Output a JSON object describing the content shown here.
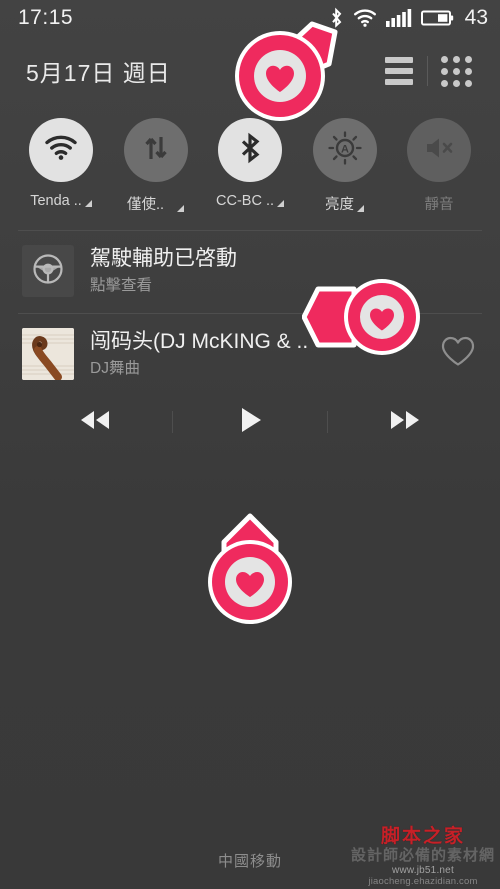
{
  "statusbar": {
    "time": "17:15",
    "battery_level": "43",
    "icons": [
      "bluetooth-icon",
      "wifi-icon",
      "signal-icon",
      "battery-icon"
    ]
  },
  "header": {
    "date": "5月17日 週日",
    "list_button": "list-view-button",
    "grid_button": "grid-view-button"
  },
  "toggles": [
    {
      "name": "wifi",
      "icon": "wifi-icon",
      "label": "Tenda ..",
      "state": "on",
      "has_caret": true
    },
    {
      "name": "data",
      "icon": "data-icon",
      "label": "僅使..",
      "state": "off",
      "has_caret": true
    },
    {
      "name": "bluetooth",
      "icon": "bluetooth-icon",
      "label": "CC-BC ..",
      "state": "on",
      "has_caret": true
    },
    {
      "name": "brightness",
      "icon": "brightness-icon",
      "label": "亮度",
      "state": "off",
      "has_caret": true
    },
    {
      "name": "mute",
      "icon": "mute-icon",
      "label": "靜音",
      "state": "dim",
      "has_caret": false
    }
  ],
  "notifications": [
    {
      "id": "driving-assist",
      "icon": "steering-wheel-icon",
      "title": "駕駛輔助已啓動",
      "subtitle": "點擊查看"
    },
    {
      "id": "music-player",
      "icon": "album-art",
      "title": "闯码头(DJ McKING &  ..",
      "subtitle": "DJ舞曲",
      "action_icon": "heart-outline-icon"
    }
  ],
  "media_controls": [
    {
      "name": "previous-button",
      "icon": "rewind-icon"
    },
    {
      "name": "play-button",
      "icon": "play-icon"
    },
    {
      "name": "next-button",
      "icon": "fast-forward-icon"
    }
  ],
  "footer": {
    "carrier": "中國移動"
  },
  "watermark": {
    "brand": "脚本之家",
    "tagline": "設計師必備的素材網",
    "url": "www.jb51.net",
    "url2": "jiaocheng.ehazidian.com"
  },
  "pointer_badges": [
    {
      "name": "heart-pointer-top",
      "direction": "up-right"
    },
    {
      "name": "heart-pointer-middle",
      "direction": "left"
    },
    {
      "name": "heart-pointer-bottom",
      "direction": "up"
    }
  ],
  "colors": {
    "accent_pink": "#ef2a5e",
    "background": "#3b3b3b",
    "toggle_on": "#e2e2e2",
    "toggle_off": "#6e6e6e",
    "text_primary": "#f0f0f0",
    "text_secondary": "#9a9a9a"
  }
}
